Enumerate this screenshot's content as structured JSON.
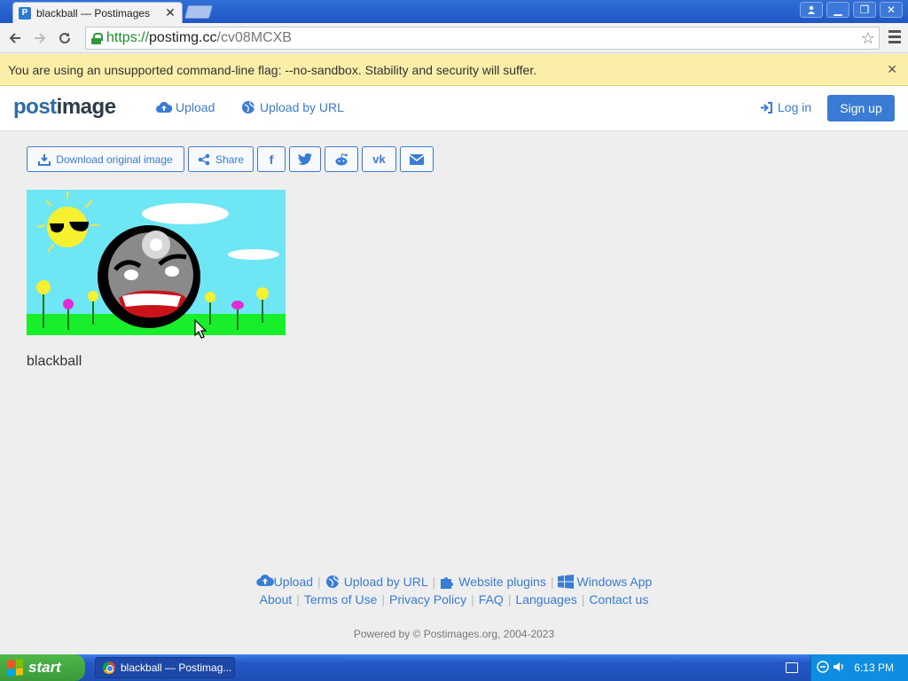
{
  "browser": {
    "tab_title": "blackball — Postimages",
    "tab_favicon": "P",
    "url_scheme": "https://",
    "url_host": "postimg.cc",
    "url_path": "/cv08MCXB",
    "infobar_text": "You are using an unsupported command-line flag: --no-sandbox. Stability and security will suffer."
  },
  "site": {
    "logo_post": "post",
    "logo_image": "image",
    "nav_upload": "Upload",
    "nav_upload_url": "Upload by URL",
    "login": "Log in",
    "signup": "Sign up",
    "accent": "#3a7bd5"
  },
  "actions": {
    "download": "Download original image",
    "share": "Share"
  },
  "image": {
    "caption": "blackball"
  },
  "footer": {
    "upload": "Upload",
    "upload_url": "Upload by URL",
    "plugins": "Website plugins",
    "windows_app": "Windows App",
    "about": "About",
    "terms": "Terms of Use",
    "privacy": "Privacy Policy",
    "faq": "FAQ",
    "languages": "Languages",
    "contact": "Contact us",
    "powered": "Powered by © Postimages.org, 2004-2023"
  },
  "taskbar": {
    "start": "start",
    "task_item": "blackball — Postimag...",
    "clock": "6:13 PM"
  }
}
